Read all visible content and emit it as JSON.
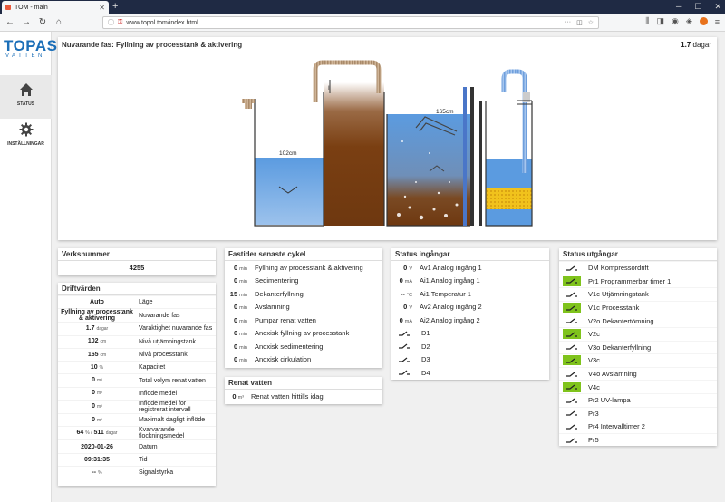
{
  "browser": {
    "tab_title": "TOM - main",
    "url": "www.topol.tom/index.html"
  },
  "logo": {
    "brand": "TOPAS",
    "sub": "VATTEN"
  },
  "sidebar": {
    "items": [
      {
        "label": "STATUS",
        "icon": "home-icon"
      },
      {
        "label": "INSTÄLLNINGAR",
        "icon": "gear-icon"
      }
    ]
  },
  "phase": {
    "title": "Nuvarande fas: Fyllning av processtank & aktivering",
    "duration_value": "1.7",
    "duration_unit": "dagar"
  },
  "diagram": {
    "label_left": "102cm",
    "label_right": "165cm",
    "colors": {
      "water": "#5b9be0",
      "sludge": "#7a3f12",
      "pipe": "#c2a88a",
      "blue_pipe": "#8ab4e8",
      "media": "#f0c020"
    }
  },
  "serial": {
    "title": "Verksnummer",
    "value": "4255"
  },
  "operational": {
    "title": "Driftvärden",
    "rows": [
      {
        "value": "Auto",
        "unit": "",
        "label": "Läge"
      },
      {
        "value": "Fyllning av processtank & aktivering",
        "unit": "",
        "label": "Nuvarande fas"
      },
      {
        "value": "1.7",
        "unit": "dagar",
        "label": "Varaktighet nuvarande fas"
      },
      {
        "value": "102",
        "unit": "cm",
        "label": "Nivå utjämningstank"
      },
      {
        "value": "165",
        "unit": "cm",
        "label": "Nivå processtank"
      },
      {
        "value": "10",
        "unit": "%",
        "label": "Kapacitet"
      },
      {
        "value": "0",
        "unit": "m³",
        "label": "Total volym renat vatten"
      },
      {
        "value": "0",
        "unit": "m³",
        "label": "Inflöde medel"
      },
      {
        "value": "0",
        "unit": "m³",
        "label": "Inflöde medel för registrerat intervall"
      },
      {
        "value": "0",
        "unit": "m³",
        "label": "Maximalt dagligt inflöde"
      },
      {
        "value": "64",
        "unit": "% /",
        "value2": "511",
        "unit2": "dagar",
        "label": "Kvarvarande flockningsmedel"
      },
      {
        "value": "2020-01-26",
        "unit": "",
        "label": "Datum"
      },
      {
        "value": "09:31:35",
        "unit": "",
        "label": "Tid"
      },
      {
        "value": "--",
        "unit": "%",
        "label": "Signalstyrka"
      }
    ]
  },
  "cycle": {
    "title": "Fastider senaste cykel",
    "rows": [
      {
        "value": "0",
        "unit": "min",
        "label": "Fyllning av processtank & aktivering"
      },
      {
        "value": "0",
        "unit": "min",
        "label": "Sedimentering"
      },
      {
        "value": "15",
        "unit": "min",
        "label": "Dekanterfyllning"
      },
      {
        "value": "0",
        "unit": "min",
        "label": "Avslamning"
      },
      {
        "value": "0",
        "unit": "min",
        "label": "Pumpar renat vatten"
      },
      {
        "value": "0",
        "unit": "min",
        "label": "Anoxisk fyllning av processtank"
      },
      {
        "value": "0",
        "unit": "min",
        "label": "Anoxisk sedimentering"
      },
      {
        "value": "0",
        "unit": "min",
        "label": "Anoxisk cirkulation"
      }
    ]
  },
  "clean": {
    "title": "Renat vatten",
    "value": "0",
    "unit": "m³",
    "label": "Renat vatten hittills idag"
  },
  "inputs": {
    "title": "Status ingångar",
    "rows": [
      {
        "value": "0",
        "unit": "V",
        "label": "Av1 Analog ingång 1"
      },
      {
        "value": "0",
        "unit": "mA",
        "label": "Ai1 Analog ingång 1"
      },
      {
        "value": "--",
        "unit": "°C",
        "label": "Ai1 Temperatur 1"
      },
      {
        "value": "0",
        "unit": "V",
        "label": "Av2 Analog ingång 2"
      },
      {
        "value": "0",
        "unit": "mA",
        "label": "Ai2 Analog ingång 2"
      }
    ],
    "digital": [
      {
        "label": "D1"
      },
      {
        "label": "D2"
      },
      {
        "label": "D3"
      },
      {
        "label": "D4"
      }
    ]
  },
  "outputs": {
    "title": "Status utgångar",
    "rows": [
      {
        "label": "DM Kompressordrift",
        "on": false
      },
      {
        "label": "Pr1 Programmerbar timer 1",
        "on": true
      },
      {
        "label": "V1c Utjämningstank",
        "on": false
      },
      {
        "label": "V1c Processtank",
        "on": true
      },
      {
        "label": "V2o Dekantertömning",
        "on": false
      },
      {
        "label": "V2c",
        "on": true
      },
      {
        "label": "V3o Dekanterfyllning",
        "on": false
      },
      {
        "label": "V3c",
        "on": true
      },
      {
        "label": "V4o Avslamning",
        "on": false
      },
      {
        "label": "V4c",
        "on": true
      },
      {
        "label": "Pr2 UV-lampa",
        "on": false
      },
      {
        "label": "Pr3",
        "on": false
      },
      {
        "label": "Pr4 Intervalltimer 2",
        "on": false
      },
      {
        "label": "Pr5",
        "on": false
      }
    ]
  }
}
